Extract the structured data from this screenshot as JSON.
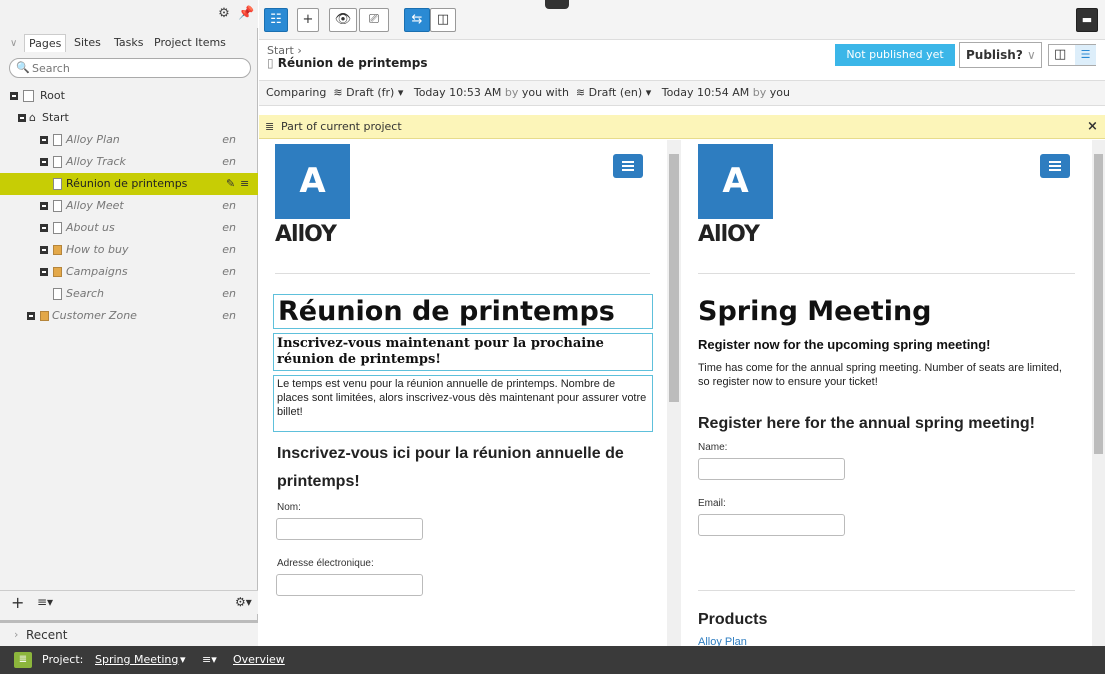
{
  "nav": {
    "tabs": [
      "Pages",
      "Sites",
      "Tasks",
      "Project Items"
    ],
    "search_placeholder": "Search",
    "tree": [
      {
        "label": "Root",
        "lang": ""
      },
      {
        "label": "Start",
        "lang": ""
      },
      {
        "label": "Alloy Plan",
        "lang": "en"
      },
      {
        "label": "Alloy Track",
        "lang": "en"
      },
      {
        "label": "Réunion de printemps",
        "lang": ""
      },
      {
        "label": "Alloy Meet",
        "lang": "en"
      },
      {
        "label": "About us",
        "lang": "en"
      },
      {
        "label": "How to buy",
        "lang": "en"
      },
      {
        "label": "Campaigns",
        "lang": "en"
      },
      {
        "label": "Search",
        "lang": "en"
      },
      {
        "label": "Customer Zone",
        "lang": "en"
      }
    ],
    "recent_label": "Recent"
  },
  "header": {
    "breadcrumb": "Start",
    "page_title": "Réunion de printemps",
    "status": "Not published yet",
    "publish_label": "Publish?"
  },
  "compare": {
    "label": "Comparing",
    "left_version": "Draft (fr)",
    "left_time": "Today 10:53 AM",
    "by1": "by",
    "you1": "you with",
    "right_version": "Draft (en)",
    "right_time": "Today 10:54 AM",
    "by2": "by",
    "you2": "you"
  },
  "project_notice": "Part of current project",
  "left_page": {
    "brand": "AllOY",
    "logo_letter": "A",
    "title": "Réunion de printemps",
    "lead": "Inscrivez-vous maintenant pour la prochaine réunion de printemps!",
    "body": "Le temps est venu pour la réunion annuelle de printemps. Nombre de places sont limitées, alors inscrivez-vous dès maintenant pour assurer votre billet!",
    "form_heading": "Inscrivez-vous ici pour la réunion annuelle de printemps!",
    "field1": "Nom:",
    "field2": "Adresse électronique:"
  },
  "right_page": {
    "brand": "AllOY",
    "logo_letter": "A",
    "title": "Spring Meeting",
    "lead": "Register now for the upcoming spring meeting!",
    "body": "Time has come for the annual spring meeting. Number of seats are limited, so register now to ensure your ticket!",
    "form_heading": "Register here for the annual spring meeting!",
    "field1": "Name:",
    "field2": "Email:",
    "products_heading": "Products",
    "product_link": "Alloy Plan"
  },
  "statusbar": {
    "project_label": "Project:",
    "project_name": "Spring Meeting",
    "overview": "Overview"
  },
  "colors": {
    "accent": "#2e7dc0",
    "selected_row": "#c7cd05",
    "not_published": "#3bb6e8",
    "notice": "#fcf5b9"
  }
}
